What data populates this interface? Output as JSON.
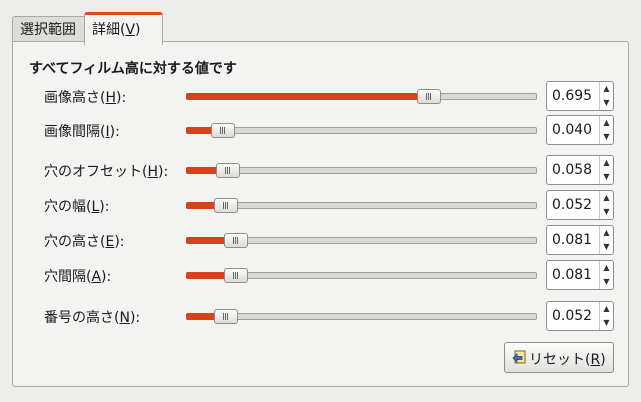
{
  "tabs": [
    {
      "label": "選択範囲",
      "active": false
    },
    {
      "label_prefix": "詳細(",
      "mnemonic": "V",
      "label_suffix": ")",
      "active": true
    }
  ],
  "section_title": "すべてフィルム高に対する値です",
  "accent_color": "#d7421a",
  "rows": [
    {
      "label_prefix": "画像高さ(",
      "mnemonic": "H",
      "label_suffix": "):",
      "value": "0.695",
      "fraction": 0.695
    },
    {
      "label_prefix": "画像間隔(",
      "mnemonic": "I",
      "label_suffix": "):",
      "value": "0.040",
      "fraction": 0.04
    },
    {
      "label_prefix": "穴のオフセット(",
      "mnemonic": "H",
      "label_suffix": "):",
      "value": "0.058",
      "fraction": 0.058
    },
    {
      "label_prefix": "穴の幅(",
      "mnemonic": "L",
      "label_suffix": "):",
      "value": "0.052",
      "fraction": 0.052
    },
    {
      "label_prefix": "穴の高さ(",
      "mnemonic": "E",
      "label_suffix": "):",
      "value": "0.081",
      "fraction": 0.081
    },
    {
      "label_prefix": "穴間隔(",
      "mnemonic": "A",
      "label_suffix": "):",
      "value": "0.081",
      "fraction": 0.081
    },
    {
      "label_prefix": "番号の高さ(",
      "mnemonic": "N",
      "label_suffix": "):",
      "value": "0.052",
      "fraction": 0.052
    }
  ],
  "reset_button": {
    "label_prefix": "リセット(",
    "mnemonic": "R",
    "label_suffix": ")",
    "icon": "reset-icon"
  }
}
